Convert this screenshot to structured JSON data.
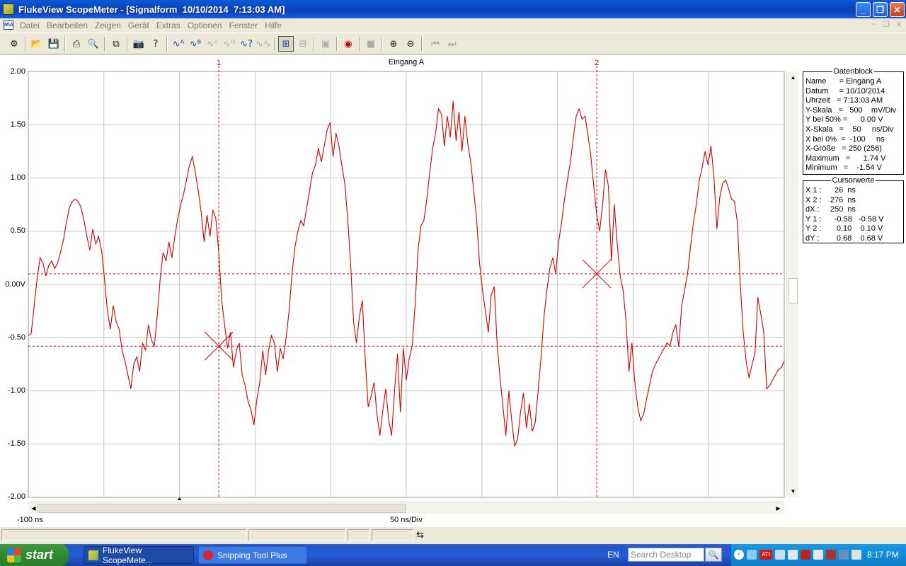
{
  "window": {
    "title": "FlukeView ScopeMeter - [Signalform  10/10/2014  7:13:03 AM]",
    "min": "_",
    "max": "❐",
    "close": "✕"
  },
  "menu": [
    "Datei",
    "Bearbeiten",
    "Zeigen",
    "Gerät",
    "Extras",
    "Optionen",
    "Fenster",
    "Hilfe"
  ],
  "menu_icon": "M\\A",
  "toolbar_icons": [
    "instrument-icon",
    "open-icon",
    "save-icon",
    "print-icon",
    "print-preview-icon",
    "copy-icon",
    "camera-icon",
    "camera-query-icon",
    "waveform-a-icon",
    "waveform-b-icon",
    "waveform-c-icon",
    "waveform-d-icon",
    "waveform-query-icon",
    "waveform-all-icon",
    "cursor-icon",
    "cursor-alt-icon",
    "window-icon",
    "record-icon",
    "stop-icon",
    "zoom-in-icon",
    "zoom-out-icon",
    "first-icon",
    "last-icon"
  ],
  "chart_data": {
    "type": "line",
    "title": "Eingang A",
    "xlabel": "50 ns/Div",
    "x_start_label": "-100 ns",
    "ylim": [
      -2.0,
      2.0
    ],
    "xlim": [
      -100,
      400
    ],
    "y_ticks": [
      "2.00",
      "1.50",
      "1.00",
      "0.50",
      "0.00V",
      "-0.50",
      "-1.00",
      "-1.50",
      "-2.00"
    ],
    "grid": true,
    "cursor_labels": [
      "1",
      "2"
    ],
    "cursors": {
      "x1_ns": 26,
      "x2_ns": 276,
      "y1_v": -0.58,
      "y2_v": 0.1
    },
    "color": "#d40000",
    "series": [
      {
        "values": [
          -0.48,
          -0.46,
          -0.2,
          0.05,
          0.25,
          0.2,
          0.08,
          0.18,
          0.22,
          0.15,
          0.2,
          0.3,
          0.42,
          0.58,
          0.72,
          0.78,
          0.8,
          0.78,
          0.72,
          0.6,
          0.45,
          0.32,
          0.52,
          0.38,
          0.45,
          0.32,
          0.05,
          -0.25,
          -0.42,
          -0.2,
          -0.35,
          -0.42,
          -0.62,
          -0.72,
          -0.85,
          -0.98,
          -0.75,
          -0.68,
          -0.82,
          -0.55,
          -0.62,
          -0.38,
          -0.52,
          -0.58,
          -0.3,
          0.05,
          0.3,
          0.22,
          0.4,
          0.25,
          0.45,
          0.62,
          0.75,
          0.85,
          0.98,
          1.12,
          1.2,
          1.05,
          0.88,
          0.68,
          0.4,
          0.65,
          0.45,
          0.7,
          0.62,
          0.3,
          -0.15,
          -0.38,
          -0.6,
          -0.45,
          -0.78,
          -0.62,
          -0.55,
          -0.85,
          -0.95,
          -1.1,
          -1.18,
          -1.32,
          -1.08,
          -0.92,
          -0.62,
          -0.85,
          -0.62,
          -0.48,
          -0.55,
          -0.82,
          -0.6,
          -0.7,
          -0.5,
          -0.25,
          0.1,
          0.35,
          0.5,
          0.6,
          0.55,
          0.72,
          0.88,
          1.05,
          1.12,
          1.28,
          1.15,
          1.3,
          1.45,
          1.52,
          1.2,
          1.42,
          1.3,
          1.12,
          0.95,
          0.62,
          0.2,
          -0.35,
          -0.55,
          -0.3,
          -0.15,
          -0.7,
          -1.15,
          -1.05,
          -0.92,
          -1.22,
          -1.42,
          -1.18,
          -0.98,
          -1.28,
          -1.42,
          -1.0,
          -0.65,
          -1.2,
          -0.6,
          -0.9,
          -0.7,
          -0.58,
          -0.2,
          0.32,
          0.55,
          0.6,
          0.8,
          1.05,
          1.28,
          1.42,
          1.65,
          1.6,
          1.3,
          1.58,
          1.38,
          1.72,
          1.35,
          1.62,
          1.25,
          1.58,
          1.32,
          1.15,
          0.88,
          0.62,
          0.2,
          -0.05,
          -0.25,
          -0.45,
          -0.1,
          -0.02,
          -0.55,
          -0.88,
          -1.15,
          -1.42,
          -1.0,
          -1.28,
          -1.52,
          -1.45,
          -1.2,
          -1.02,
          -1.35,
          -1.12,
          -1.38,
          -1.3,
          -1.0,
          -0.68,
          -0.3,
          -0.05,
          0.15,
          0.25,
          0.1,
          0.4,
          0.58,
          0.8,
          0.98,
          1.15,
          1.38,
          1.58,
          1.65,
          1.55,
          1.58,
          1.4,
          1.2,
          0.92,
          0.65,
          0.5,
          0.75,
          1.08,
          0.92,
          0.22,
          0.75,
          0.38,
          0.08,
          -0.05,
          -0.35,
          -0.82,
          -0.55,
          -0.92,
          -1.15,
          -1.28,
          -1.22,
          -1.08,
          -0.95,
          -0.82,
          -0.75,
          -0.7,
          -0.65,
          -0.6,
          -0.55,
          -0.58,
          -0.45,
          -0.38,
          -0.58,
          -0.2,
          -0.05,
          0.1,
          0.35,
          0.58,
          0.75,
          0.98,
          1.1,
          1.25,
          1.12,
          1.3,
          1.0,
          0.52,
          0.82,
          0.95,
          0.98,
          0.9,
          0.8,
          0.78,
          0.58,
          0.0,
          -0.45,
          -0.72,
          -0.88,
          -0.75,
          -0.65,
          -0.12,
          -0.28,
          -0.45,
          -0.98,
          -0.95,
          -0.9,
          -0.85,
          -0.8,
          -0.78,
          -0.72
        ]
      }
    ]
  },
  "datenblock": {
    "title": "Datenblock",
    "rows": [
      "Name      = Eingang A",
      "Datum     = 10/10/2014",
      "Uhrzeit   = 7:13:03 AM",
      "Y-Skala   =   500    mV/Div",
      "Y bei 50% =      0.00 V",
      "X-Skala   =    50     ns/Div",
      "X bei 0%  =  -100     ns",
      "X-Größe   = 250 (256)",
      "Maximum   =      1.74 V",
      "Minimum   =    -1.54 V"
    ]
  },
  "cursorwerte": {
    "title": "Cursorwerte",
    "rows": [
      "X 1 :      26  ns",
      "X 2 :    276  ns",
      "dX :     250  ns",
      "Y 1 :      -0.58   -0.58 V",
      "Y 2 :       0.10    0.10 V",
      "dY :        0.68    0.68 V"
    ]
  },
  "taskbar": {
    "start": "start",
    "items": [
      "FlukeView ScopeMete...",
      "Snipping Tool Plus"
    ],
    "lang": "EN",
    "search_placeholder": "Search Desktop",
    "clock": "8:17 PM"
  }
}
